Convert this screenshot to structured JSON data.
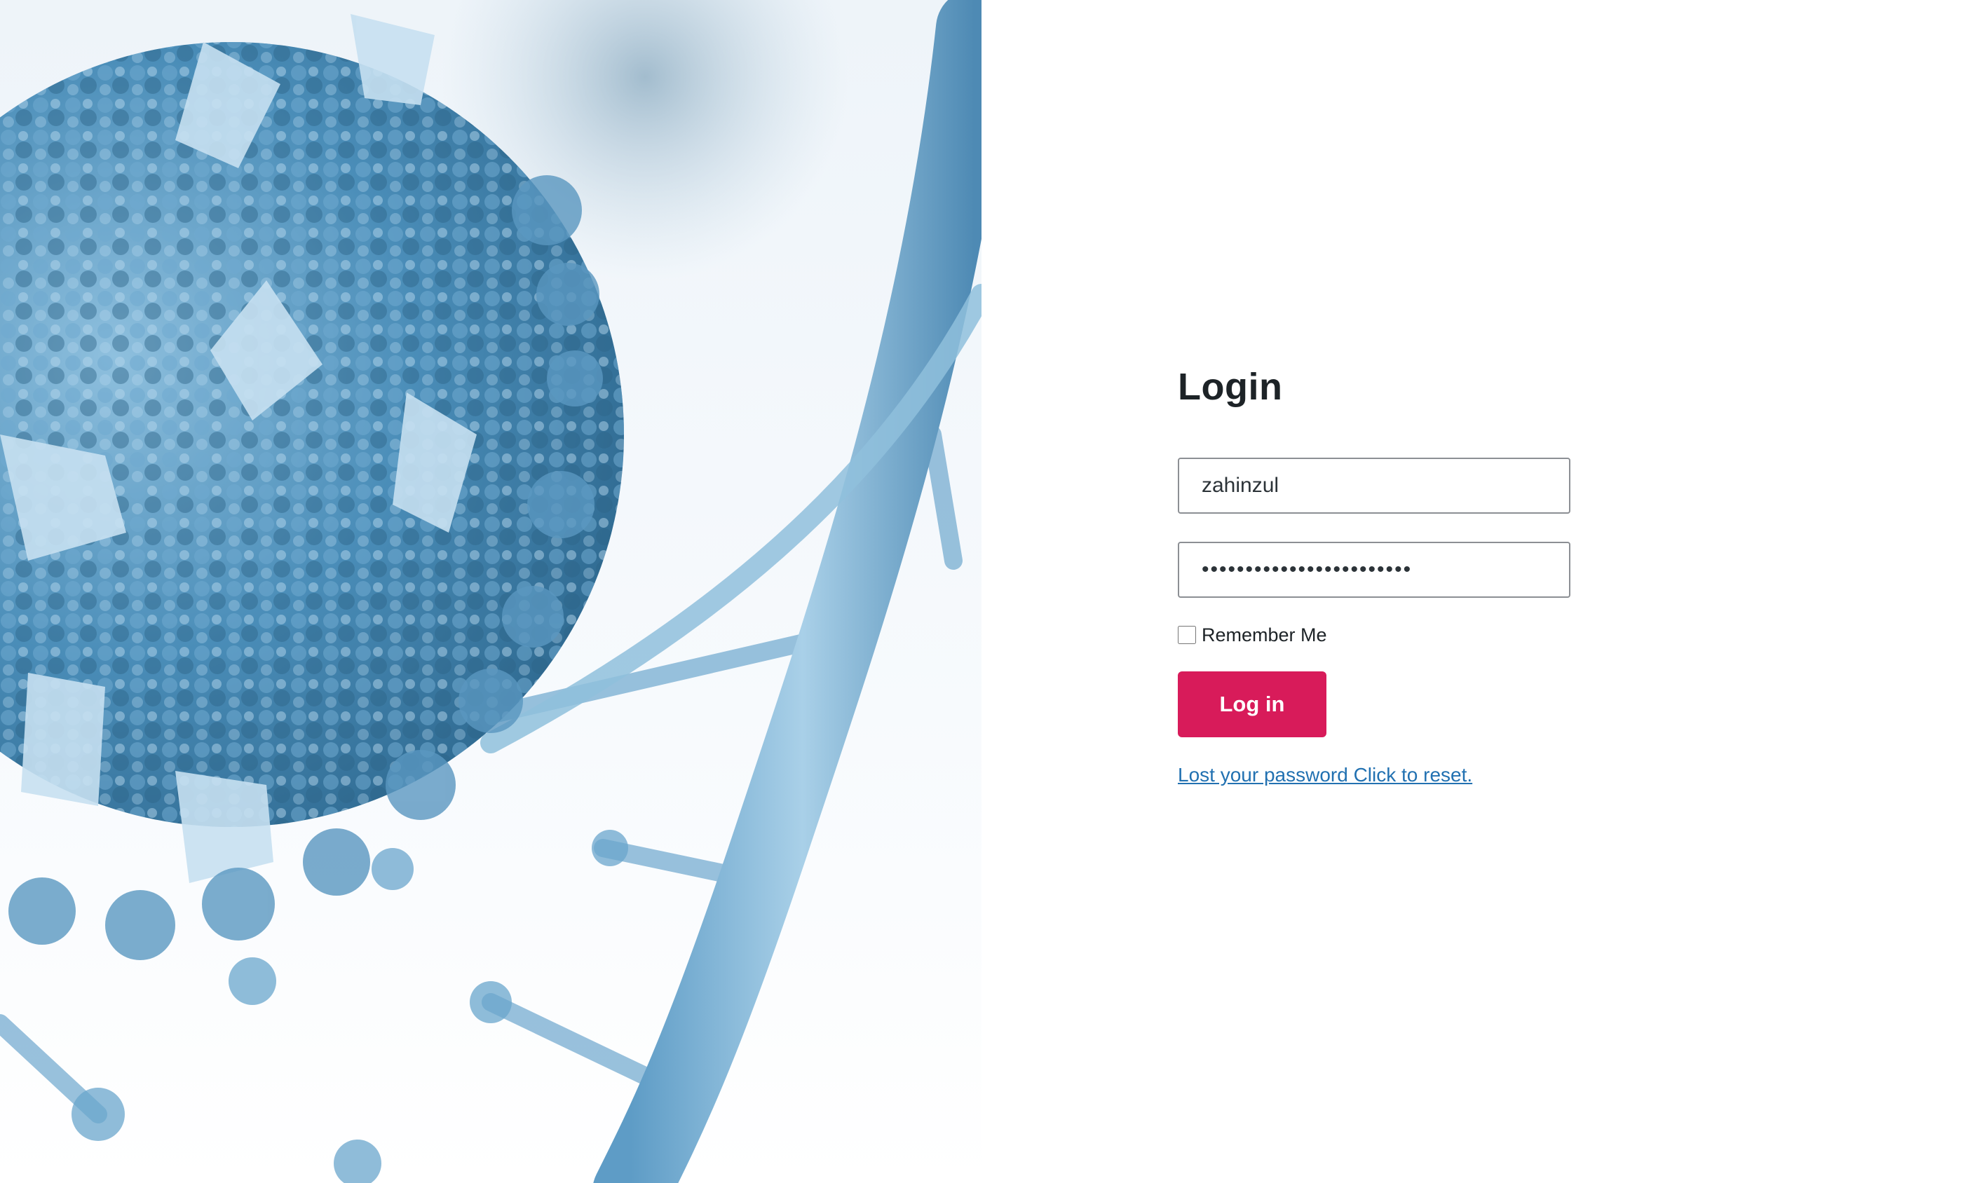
{
  "hero": {
    "image_description_icon": "virus-dna-illustration",
    "palette": {
      "dark": "#3f7fa8",
      "mid": "#6aa6cc",
      "light": "#b7d6ea"
    }
  },
  "login": {
    "title": "Login",
    "username_value": "zahinzul",
    "password_value": "••••••••••••••••••••••••",
    "remember_label": "Remember Me",
    "remember_checked": false,
    "submit_label": "Log in",
    "reset_link_text": "Lost your password Click to reset."
  },
  "colors": {
    "button": "#d81b5a",
    "link": "#2271b1",
    "text": "#1d2327",
    "border": "#8c8f94"
  }
}
